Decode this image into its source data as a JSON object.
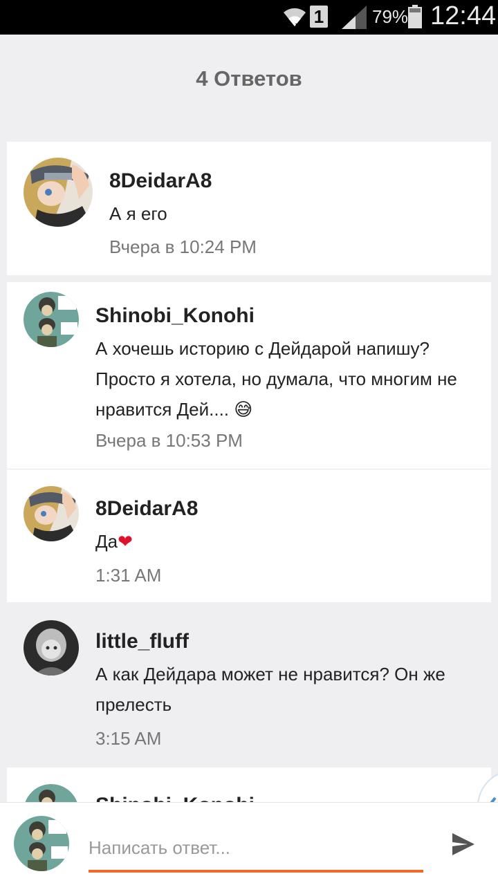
{
  "status_bar": {
    "battery_percent": "79%",
    "time": "12:44",
    "sim_slot": "1",
    "icons": [
      "wifi-icon",
      "sim-icon",
      "signal-icon",
      "battery-icon"
    ]
  },
  "header": {
    "title": "4 Ответов"
  },
  "comments": [
    {
      "username": "8DeidarA8",
      "text": "А я его",
      "timestamp": "Вчера в 10:24 PM"
    },
    {
      "username": "Shinobi_Konohi",
      "text": "А хочешь историю с Дейдарой напишу? Просто я  хотела, но думала, что многим не нравится Дей.... ",
      "emoji": "😅",
      "timestamp": "Вчера в 10:53 PM"
    },
    {
      "username": "8DeidarA8",
      "text": "Да",
      "emoji": "❤",
      "timestamp": "1:31 AM"
    },
    {
      "username": "little_fluff",
      "text": "А как Дейдара может не нравится? Он же прелесть",
      "timestamp": "3:15 AM"
    },
    {
      "username": "Shinobi_Konohi"
    }
  ],
  "reply": {
    "placeholder": "Написать ответ...",
    "accent_color": "#f26a2a"
  }
}
